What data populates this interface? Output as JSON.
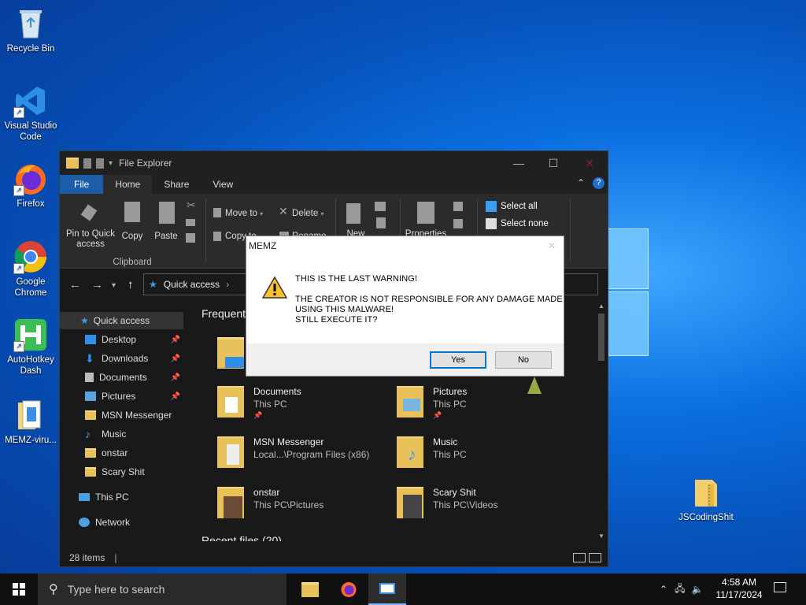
{
  "desktop": {
    "icons": [
      {
        "label": "Recycle Bin"
      },
      {
        "label": "Visual Studio Code"
      },
      {
        "label": "Firefox"
      },
      {
        "label": "Google Chrome"
      },
      {
        "label": "AutoHotkey Dash"
      },
      {
        "label": "MEMZ-viru..."
      },
      {
        "label": "JSCodingShit"
      }
    ]
  },
  "explorer": {
    "title": "File Explorer",
    "tabs": [
      "File",
      "Home",
      "Share",
      "View"
    ],
    "ribbon": {
      "pin_to_quick_access": "Pin to Quick access",
      "copy": "Copy",
      "paste": "Paste",
      "clipboard_group": "Clipboard",
      "move_to": "Move to",
      "copy_to": "Copy to",
      "delete": "Delete",
      "rename": "Rename",
      "new": "New",
      "properties": "Properties",
      "select_all": "Select all",
      "select_none": "Select none"
    },
    "address": {
      "path": "Quick access",
      "separator": "›"
    },
    "nav": [
      {
        "label": "Quick access",
        "pinned": false
      },
      {
        "label": "Desktop",
        "pinned": true
      },
      {
        "label": "Downloads",
        "pinned": true
      },
      {
        "label": "Documents",
        "pinned": true
      },
      {
        "label": "Pictures",
        "pinned": true
      },
      {
        "label": "MSN Messenger",
        "pinned": false
      },
      {
        "label": "Music",
        "pinned": false
      },
      {
        "label": "onstar",
        "pinned": false
      },
      {
        "label": "Scary Shit",
        "pinned": false
      },
      {
        "label": "This PC",
        "pinned": false
      },
      {
        "label": "Network",
        "pinned": false
      }
    ],
    "frequent_header": "Frequent",
    "tiles": [
      {
        "name": "Documents",
        "location": "This PC",
        "pinned": true
      },
      {
        "name": "Pictures",
        "location": "This PC",
        "pinned": true
      },
      {
        "name": "MSN Messenger",
        "location": "Local...\\Program Files (x86)",
        "pinned": false
      },
      {
        "name": "Music",
        "location": "This PC",
        "pinned": false
      },
      {
        "name": "onstar",
        "location": "This PC\\Pictures",
        "pinned": false
      },
      {
        "name": "Scary Shit",
        "location": "This PC\\Videos",
        "pinned": false
      }
    ],
    "recent_header": "Recent files (20)",
    "status": "28 items"
  },
  "dialog": {
    "title": "MEMZ",
    "line1": "THIS IS THE LAST WARNING!",
    "line2": "THE CREATOR IS NOT RESPONSIBLE FOR ANY DAMAGE MADE",
    "line3": "USING THIS MALWARE!",
    "line4": "STILL EXECUTE IT?",
    "yes": "Yes",
    "no": "No"
  },
  "taskbar": {
    "search_placeholder": "Type here to search",
    "time": "4:58 AM",
    "date": "11/17/2024"
  },
  "colors": {
    "accent": "#0078d7",
    "file_tab": "#1c5ca8",
    "desktop": "#0a6fe0"
  }
}
